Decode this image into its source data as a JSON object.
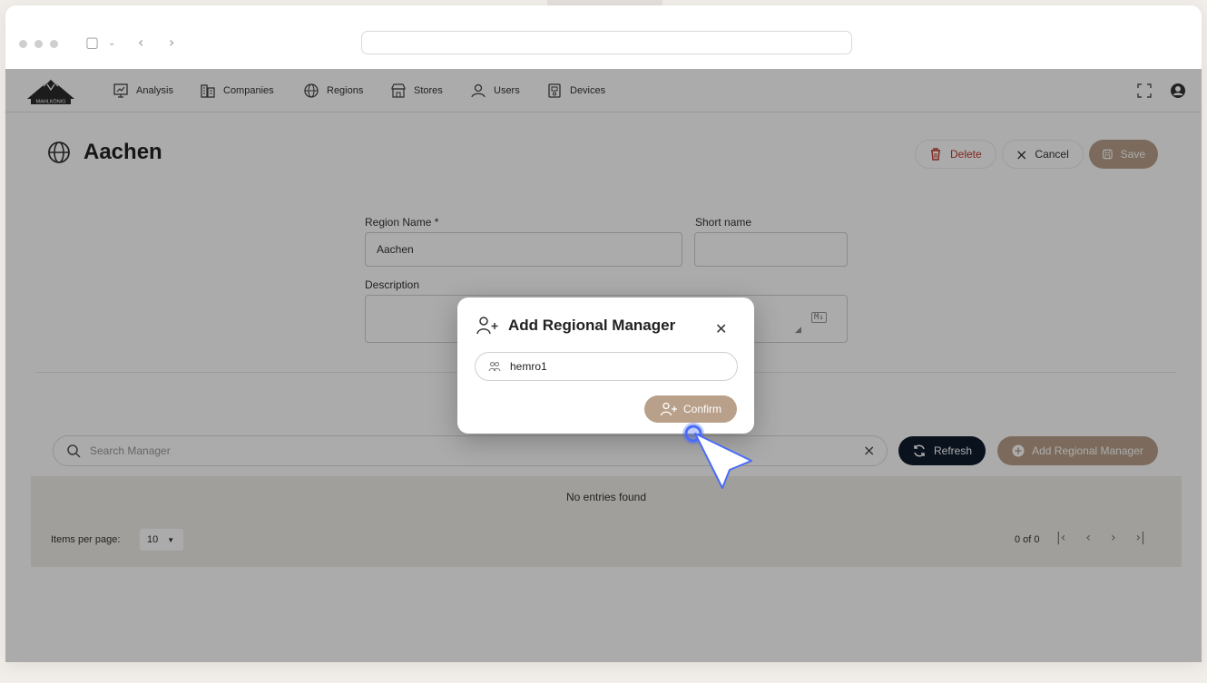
{
  "nav": {
    "items": [
      {
        "label": "Analysis",
        "icon": "analysis-icon"
      },
      {
        "label": "Companies",
        "icon": "companies-icon"
      },
      {
        "label": "Regions",
        "icon": "globe-icon"
      },
      {
        "label": "Stores",
        "icon": "store-icon"
      },
      {
        "label": "Users",
        "icon": "users-icon"
      },
      {
        "label": "Devices",
        "icon": "device-icon"
      }
    ],
    "logo_text": "MAHLKÖNIG"
  },
  "page": {
    "title": "Aachen",
    "actions": {
      "delete": "Delete",
      "cancel": "Cancel",
      "save": "Save"
    }
  },
  "form": {
    "region_name_label": "Region Name *",
    "region_name_value": "Aachen",
    "short_name_label": "Short name",
    "short_name_value": "",
    "description_label": "Description",
    "markdown_badge": "M↓"
  },
  "managers": {
    "search_placeholder": "Search Manager",
    "refresh_label": "Refresh",
    "add_label": "Add Regional Manager",
    "empty_text": "No entries found",
    "items_per_page_label": "Items per page:",
    "items_per_page_value": "10",
    "range_label": "0 of 0"
  },
  "dialog": {
    "title": "Add Regional Manager",
    "input_value": "hemro1",
    "confirm_label": "Confirm"
  },
  "colors": {
    "accent": "#b9a08a",
    "dark_button": "#0f1c2e",
    "danger": "#c0392b",
    "cursor_blue": "#4a6cf7"
  }
}
